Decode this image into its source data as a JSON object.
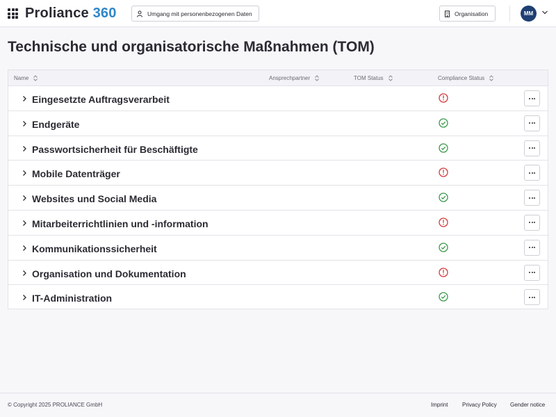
{
  "header": {
    "brand_name": "Proliance",
    "brand_number": "360",
    "data_button_label": "Umgang mit personenbezogenen Daten",
    "org_button_label": "Organisation",
    "avatar_initials": "MM"
  },
  "page": {
    "title": "Technische und organisatorische Maßnahmen (TOM)"
  },
  "table": {
    "columns": [
      "Name",
      "Ansprechpartner",
      "TOM Status",
      "Compliance Status"
    ],
    "rows": [
      {
        "label": "Eingesetzte Auftragsverarbeit",
        "status": "warning"
      },
      {
        "label": "Endgeräte",
        "status": "ok"
      },
      {
        "label": "Passwortsicherheit für Beschäftigte",
        "status": "ok"
      },
      {
        "label": "Mobile Datenträger",
        "status": "warning"
      },
      {
        "label": "Websites und Social Media",
        "status": "ok"
      },
      {
        "label": "Mitarbeiterrichtlinien und -information",
        "status": "warning"
      },
      {
        "label": "Kommunikationssicherheit",
        "status": "ok"
      },
      {
        "label": "Organisation und Dokumentation",
        "status": "warning"
      },
      {
        "label": "IT-Administration",
        "status": "ok"
      }
    ]
  },
  "footer": {
    "copyright": "© Copyright 2025 PROLIANCE GmbH",
    "imprint": "Imprint",
    "privacy": "Privacy Policy",
    "gender": "Gender notice"
  },
  "colors": {
    "brand_accent": "#2f86c9",
    "avatar_bg": "#1f3f73",
    "status_ok": "#3a9a4b",
    "status_warning": "#d33a3a"
  },
  "icons": {
    "apps": "grid-icon",
    "data_button": "person-icon",
    "org_button": "building-icon",
    "sort": "sort-icon",
    "row_expand": "chevron-right-icon",
    "status_ok": "check-circle-icon",
    "status_warning": "info-circle-icon",
    "row_menu": "more-icon"
  }
}
